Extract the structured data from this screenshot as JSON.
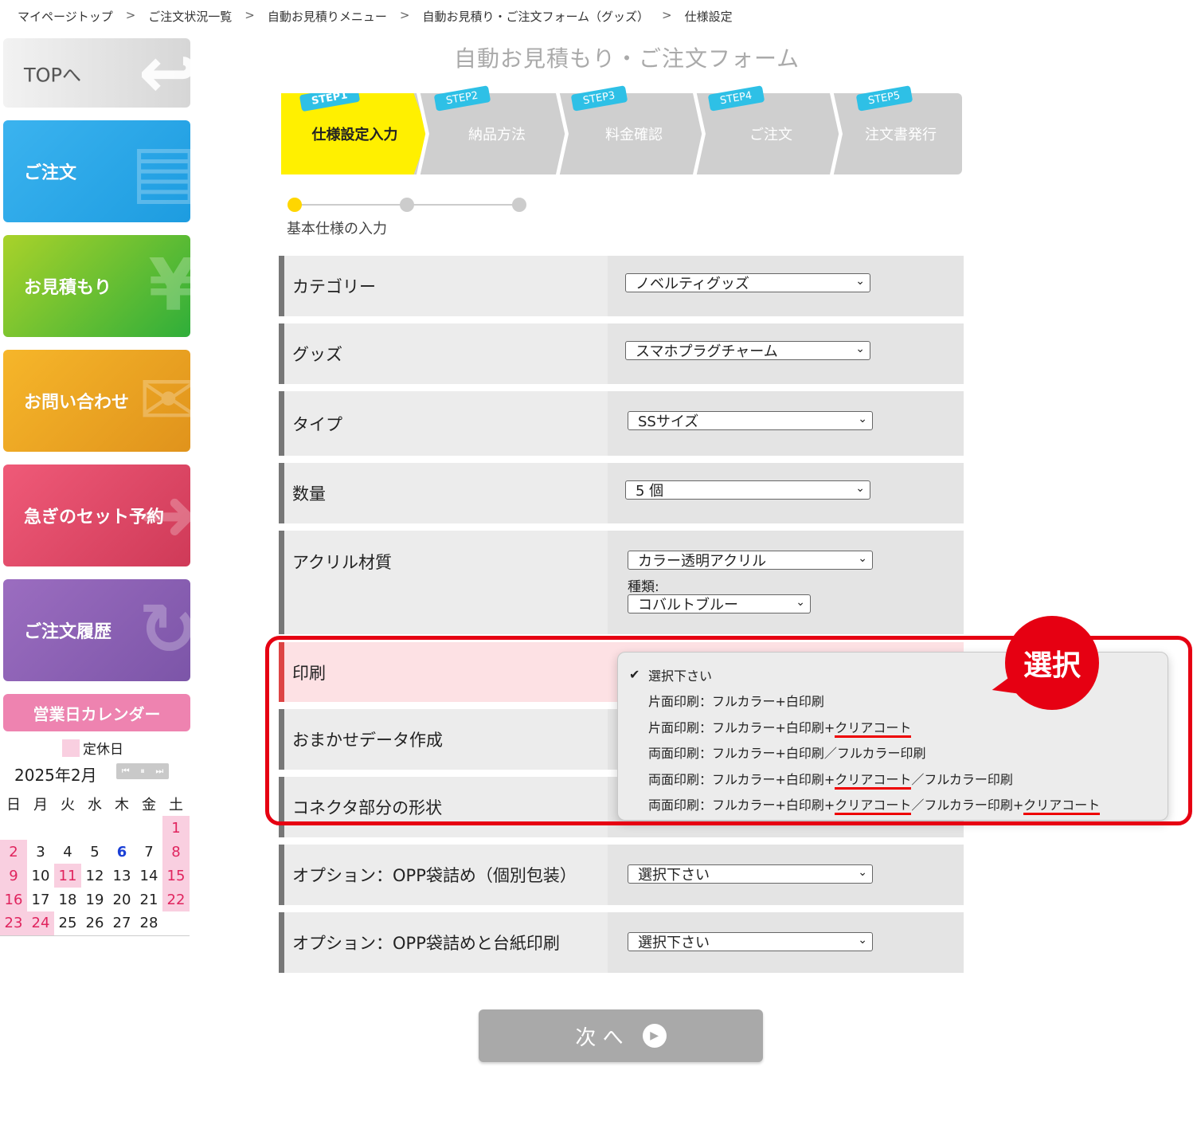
{
  "breadcrumb": [
    "マイページトップ",
    "ご注文状況一覧",
    "自動お見積りメニュー",
    "自動お見積り・ご注文フォーム（グッズ）",
    "仕様設定"
  ],
  "breadcrumb_sep": ">",
  "sidebar": {
    "top": "TOPへ",
    "order": "ご注文",
    "estimate": "お見積もり",
    "inquiry": "お問い合わせ",
    "rush": "急ぎのセット予約",
    "history": "ご注文履歴",
    "calendar_title": "営業日カレンダー"
  },
  "calendar": {
    "holiday_label": "定休日",
    "month": "2025年2月",
    "weekdays": [
      "日",
      "月",
      "火",
      "水",
      "木",
      "金",
      "土"
    ]
  },
  "form_title": "自動お見積もり・ご注文フォーム",
  "steps": [
    {
      "tag": "STEP1",
      "label": "仕様設定入力"
    },
    {
      "tag": "STEP2",
      "label": "納品方法"
    },
    {
      "tag": "STEP3",
      "label": "料金確認"
    },
    {
      "tag": "STEP4",
      "label": "ご注文"
    },
    {
      "tag": "STEP5",
      "label": "注文書発行"
    }
  ],
  "sub_step": "基本仕様の入力",
  "fields": {
    "category": {
      "label": "カテゴリー",
      "value": "ノベルティグッズ"
    },
    "goods": {
      "label": "グッズ",
      "value": "スマホプラグチャーム"
    },
    "type": {
      "label": "タイプ",
      "value": "SSサイズ"
    },
    "qty": {
      "label": "数量",
      "value": "5 個"
    },
    "acrylic": {
      "label": "アクリル材質",
      "value": "カラー透明アクリル",
      "kind_label": "種類:",
      "kind_value": "コバルトブルー"
    },
    "print": {
      "label": "印刷"
    },
    "omakase": {
      "label": "おまかせデータ作成"
    },
    "connector": {
      "label": "コネクタ部分の形状"
    },
    "opp": {
      "label": "オプション：OPP袋詰め（個別包装）",
      "value": "選択下さい"
    },
    "opp_card": {
      "label": "オプション：OPP袋詰めと台紙印刷",
      "value": "選択下さい"
    }
  },
  "print_options": {
    "o1": "選択下さい",
    "o2": "片面印刷：フルカラー+白印刷",
    "o3a": "片面印刷：フルカラー+白印刷+",
    "o3b": "クリアコート",
    "o4": "両面印刷：フルカラー+白印刷／フルカラー印刷",
    "o5a": "両面印刷：フルカラー+白印刷+",
    "o5b": "クリアコート",
    "o5c": "／フルカラー印刷",
    "o6a": "両面印刷：フルカラー+白印刷+",
    "o6b": "クリアコート",
    "o6c": "／フルカラー印刷+",
    "o6d": "クリアコート"
  },
  "annotation": "選択",
  "next_button": "次 へ"
}
